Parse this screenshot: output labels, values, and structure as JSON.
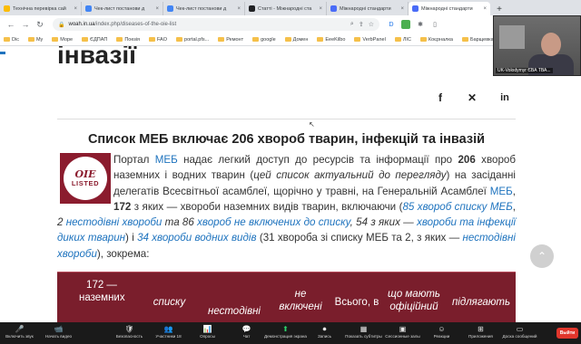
{
  "browser": {
    "tabs": [
      {
        "label": "Технічна перевірка сай",
        "color": "#fbbc04"
      },
      {
        "label": "Чек-лист постанови д",
        "color": "#4285f4"
      },
      {
        "label": "Чек-лист постанови д",
        "color": "#4285f4"
      },
      {
        "label": "Статті - Міжнародні ста",
        "color": "#202124"
      },
      {
        "label": "Міжнародні стандарти",
        "color": "#4a6cf7"
      },
      {
        "label": "Міжнародні стандарти",
        "color": "#4a6cf7",
        "active": true
      }
    ],
    "url_host": "woah.in.ua",
    "url_path": "/index.php/diseases-of-the-oie-list",
    "bookmarks": [
      "Dic",
      "My",
      "Море",
      "ЄДПАП",
      "Поезія",
      "FAO",
      "portal.pfs...",
      "Ремонт",
      "google",
      "Домен",
      "EeeKilbo",
      "VerbPanel",
      "ЛІС",
      "Коєрналка",
      "Барщевка"
    ]
  },
  "page": {
    "heading": "інвазії",
    "section_title": "Список МЕБ включає 206 хвороб тварин, інфекцій та інвазій",
    "logo": {
      "top": "OIE",
      "bottom": "LISTED"
    },
    "para": {
      "p1": "Портал ",
      "meb1": "МЕБ",
      "p2": " надає легкий доступ до ресурсів та інформації про ",
      "n206": "206",
      "p3": " хвороб наземних і водних тварин (",
      "note": "цей список актуальний до перегляду",
      "p4": ") на засіданні делегатів Всесвітньої асамблеї, щорічно у травні, на Генеральній Асамблеї ",
      "meb2": "МЕБ",
      "p5": ", ",
      "n172": "172",
      "p6": " з яких — хвороби наземних видів тварин, включаючи (",
      "l1": "85 хвороб списку МЕБ",
      "p7": ", ",
      "l2a": "2 ",
      "l2": "нестодівні хвороби",
      "p8": " та 86 ",
      "l3": "хвороб не включених до списку",
      "p9": ", 54 з яких — ",
      "l4": "хвороби та інфекції диких тварин",
      "p10": ") і ",
      "l5": "34 хвороби водних видів",
      "p11": " (31 хвороба зі списку МЕБ та 2, з яких — ",
      "l6": "нестодівні хвороби",
      "p12": "), зокрема:"
    },
    "table_headers": [
      "172 — наземних",
      "списку",
      "нестодівні",
      "не включені",
      "Всього, в",
      "що мають офіційний",
      "підлягають"
    ]
  },
  "video": {
    "name": "UK-Volodymyr ЄВА ТВА..."
  },
  "zoom": {
    "items": [
      {
        "icon": "🎤",
        "label": "Включить звук"
      },
      {
        "icon": "📹",
        "label": "Начать видео"
      },
      {
        "icon": "🛡",
        "label": "Безопасность"
      },
      {
        "icon": "👥",
        "label": "Участники 18"
      },
      {
        "icon": "📊",
        "label": "Опросы"
      },
      {
        "icon": "💬",
        "label": "Чат"
      },
      {
        "icon": "⬆",
        "label": "Демонстрация экрана"
      },
      {
        "icon": "⏺",
        "label": "Запись"
      },
      {
        "icon": "▦",
        "label": "Показать субтитры"
      },
      {
        "icon": "▣",
        "label": "Сессионные залы"
      },
      {
        "icon": "☺",
        "label": "Реакции"
      },
      {
        "icon": "⊞",
        "label": "Приложения"
      },
      {
        "icon": "▭",
        "label": "Доска сообщений"
      }
    ],
    "end_label": "Выйти"
  },
  "colors": {
    "accent": "#1e73be",
    "table_header": "#7a1e2c",
    "logo": "#8b1c2e"
  }
}
